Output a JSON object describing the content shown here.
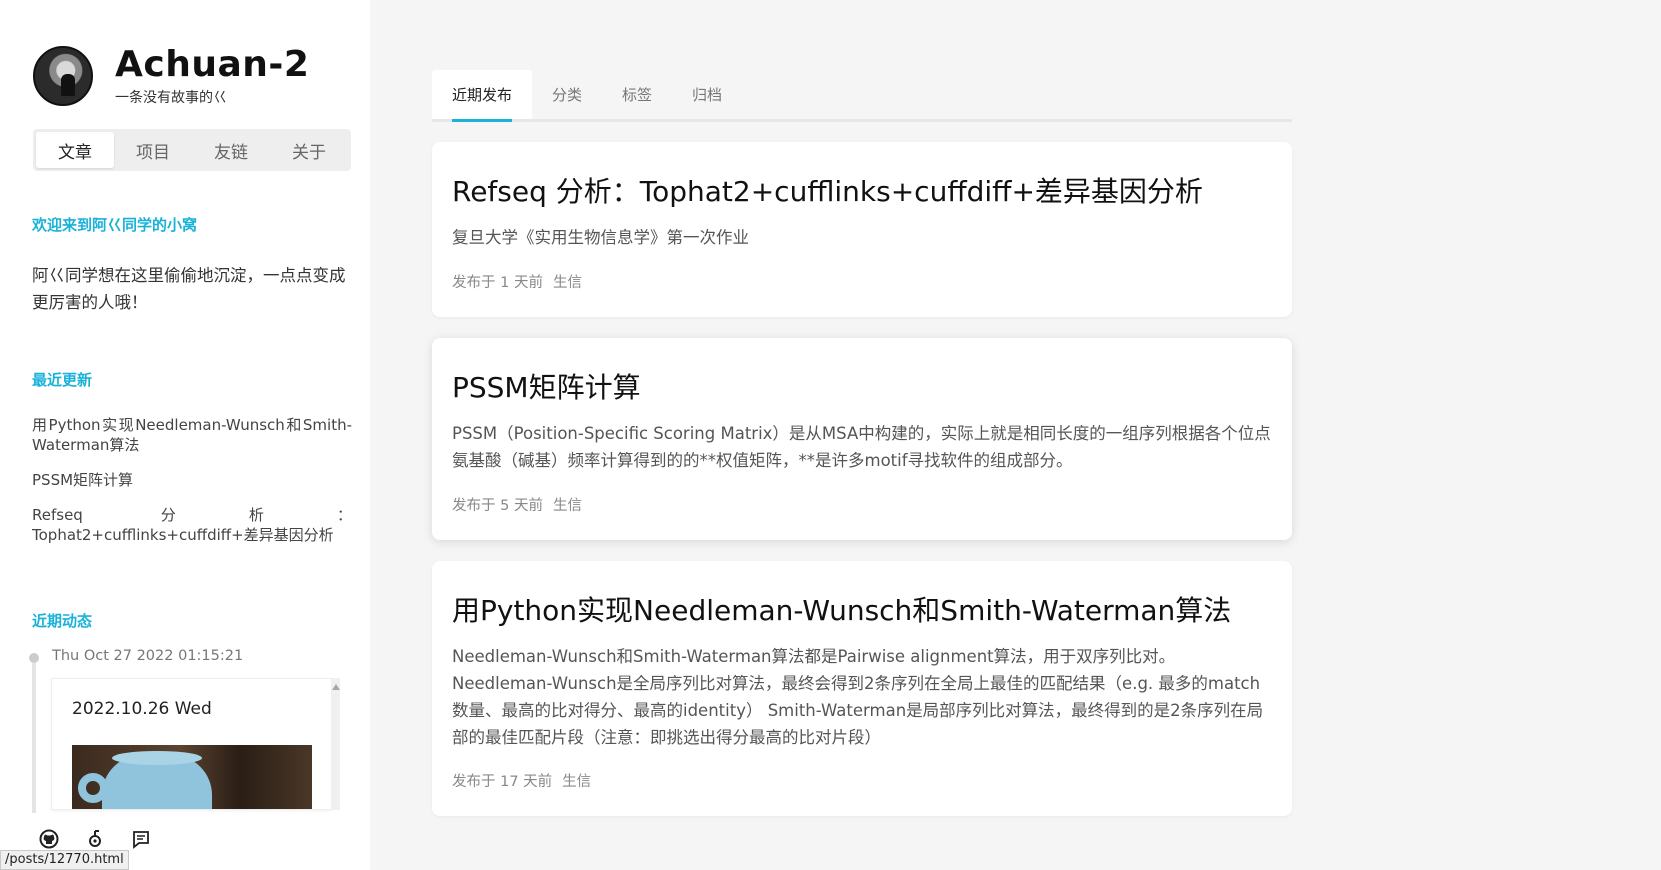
{
  "profile": {
    "site_title": "Achuan-2",
    "subtitle": "一条没有故事的巜"
  },
  "nav_tabs": [
    {
      "label": "文章",
      "active": true
    },
    {
      "label": "项目",
      "active": false
    },
    {
      "label": "友链",
      "active": false
    },
    {
      "label": "关于",
      "active": false
    }
  ],
  "welcome": {
    "heading": "欢迎来到阿巜同学的小窝",
    "text": "阿巜同学想在这里偷偷地沉淀，一点点变成更厉害的人哦！"
  },
  "recent_updates": {
    "heading": "最近更新",
    "items": [
      "用Python实现Needleman-Wunsch和Smith-Waterman算法",
      "PSSM矩阵计算",
      "Refseq 分析： Tophat2+cufflinks+cuffdiff+差异基因分析"
    ]
  },
  "recent_moments": {
    "heading": "近期动态",
    "date": "Thu Oct 27 2022 01:15:21",
    "card_title": "2022.10.26 Wed"
  },
  "social_icons": [
    "github-icon",
    "rss-icon",
    "message-icon"
  ],
  "status_url": "/posts/12770.html",
  "main_tabs": [
    {
      "label": "近期发布",
      "active": true
    },
    {
      "label": "分类",
      "active": false
    },
    {
      "label": "标签",
      "active": false
    },
    {
      "label": "归档",
      "active": false
    }
  ],
  "posts": [
    {
      "title": "Refseq 分析：Tophat2+cufflinks+cuffdiff+差异基因分析",
      "excerpt": "复旦大学《实用生物信息学》第一次作业",
      "date": "发布于 1 天前",
      "tag": "生信"
    },
    {
      "title": "PSSM矩阵计算",
      "excerpt": "PSSM（Position-Specific Scoring Matrix）是从MSA中构建的，实际上就是相同长度的一组序列根据各个位点氨基酸（碱基）频率计算得到的的**权值矩阵，**是许多motif寻找软件的组成部分。",
      "date": "发布于 5 天前",
      "tag": "生信"
    },
    {
      "title": "用Python实现Needleman-Wunsch和Smith-Waterman算法",
      "excerpt": "Needleman-Wunsch和Smith-Waterman算法都是Pairwise alignment算法，用于双序列比对。Needleman-Wunsch是全局序列比对算法，最终会得到2条序列在全局上最佳的匹配结果（e.g. 最多的match数量、最高的比对得分、最高的identity） Smith-Waterman是局部序列比对算法，最终得到的是2条序列在局部的最佳匹配片段（注意：即挑选出得分最高的比对片段）",
      "date": "发布于 17 天前",
      "tag": "生信"
    }
  ],
  "colors": {
    "accent": "#1ab2d9",
    "background": "#f5f5f5",
    "card": "#ffffff"
  }
}
